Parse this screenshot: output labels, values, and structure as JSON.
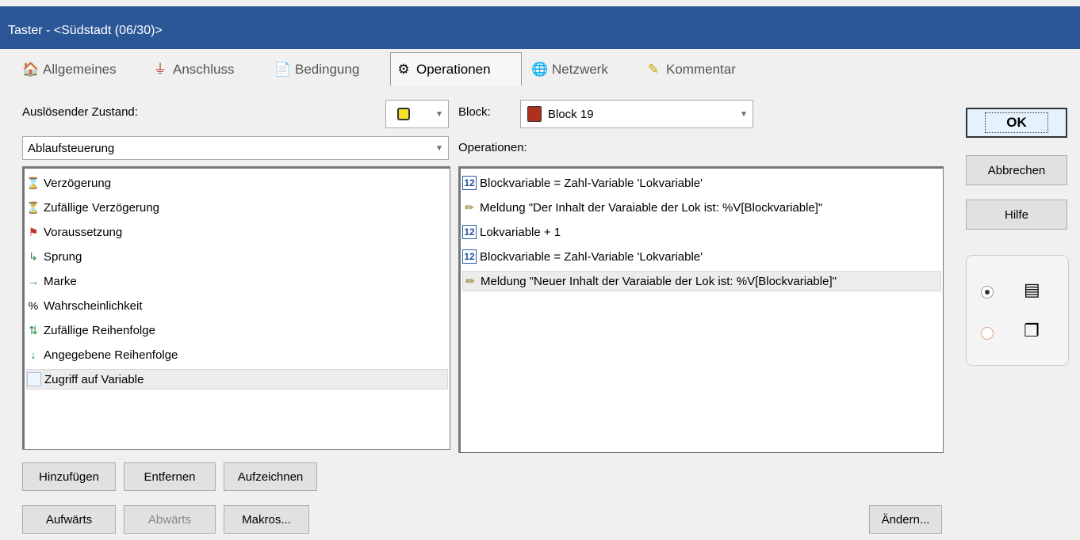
{
  "window": {
    "title": "Taster - <Südstadt (06/30)>"
  },
  "tabs": [
    {
      "label": "Allgemeines",
      "icon": "general-icon"
    },
    {
      "label": "Anschluss",
      "icon": "plug-icon"
    },
    {
      "label": "Bedingung",
      "icon": "condition-icon"
    },
    {
      "label": "Operationen",
      "icon": "operations-icon",
      "active": true
    },
    {
      "label": "Netzwerk",
      "icon": "network-icon"
    },
    {
      "label": "Kommentar",
      "icon": "comment-icon"
    }
  ],
  "left": {
    "trigger_label": "Auslösender Zustand:",
    "category_value": "Ablaufsteuerung",
    "items": [
      {
        "label": "Verzögerung",
        "icon": "hourglass-icon"
      },
      {
        "label": "Zufällige Verzögerung",
        "icon": "random-delay-icon"
      },
      {
        "label": "Voraussetzung",
        "icon": "precondition-icon"
      },
      {
        "label": "Sprung",
        "icon": "jump-icon"
      },
      {
        "label": "Marke",
        "icon": "mark-icon"
      },
      {
        "label": "Wahrscheinlichkeit",
        "icon": "percent-icon"
      },
      {
        "label": "Zufällige Reihenfolge",
        "icon": "random-order-icon"
      },
      {
        "label": "Angegebene Reihenfolge",
        "icon": "given-order-icon"
      },
      {
        "label": "Zugriff auf Variable",
        "icon": "variable-icon",
        "selected": true
      }
    ]
  },
  "right": {
    "block_label": "Block:",
    "block_value": "Block 19",
    "operations_label": "Operationen:",
    "operations": [
      {
        "label": "Blockvariable = Zahl-Variable 'Lokvariable'",
        "icon": "number-12-icon"
      },
      {
        "label": "Meldung \"Der Inhalt der Varaiable der Lok ist: %V[Blockvariable]\"",
        "icon": "pencil-icon"
      },
      {
        "label": "Lokvariable + 1",
        "icon": "number-12-icon"
      },
      {
        "label": "Blockvariable = Zahl-Variable 'Lokvariable'",
        "icon": "number-12-icon"
      },
      {
        "label": "Meldung \"Neuer Inhalt der Varaiable der Lok ist: %V[Blockvariable]\"",
        "icon": "pencil-icon",
        "selected": true
      }
    ]
  },
  "buttons": {
    "add": "Hinzufügen",
    "remove": "Entfernen",
    "record": "Aufzeichnen",
    "up": "Aufwärts",
    "down": "Abwärts",
    "macros": "Makros...",
    "change": "Ändern...",
    "ok": "OK",
    "cancel": "Abbrechen",
    "help": "Hilfe"
  },
  "view_mode": {
    "selected": "list",
    "options": [
      "list-view-icon",
      "tiles-view-icon"
    ]
  }
}
